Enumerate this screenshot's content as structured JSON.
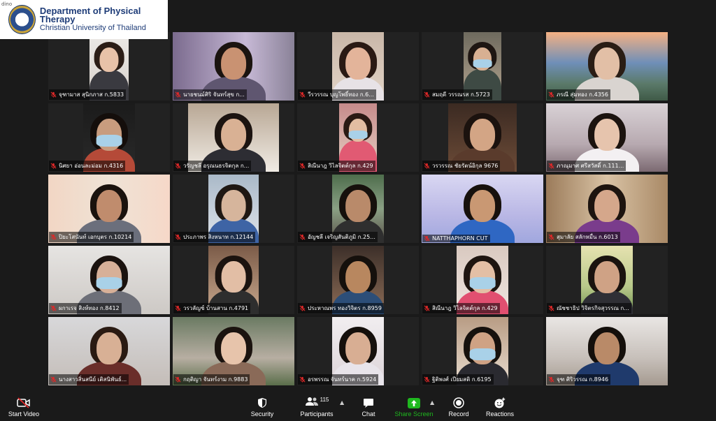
{
  "watermark": "dino",
  "logo": {
    "line1": "Department of Physical Therapy",
    "line2": "Christian University of Thailand"
  },
  "participants": [
    {
      "name": "จุฑามาส สุนิกภาส ก.5833"
    },
    {
      "name": "นายชนม์ศิริ จันทร์สุข ก..."
    },
    {
      "name": "วีรวรรณ บุญโพธิ์ทอง ก.6..."
    },
    {
      "name": "สมฤดี วรรณรส ก.5723"
    },
    {
      "name": "ภรณี สุ่มทอง ก.4356"
    },
    {
      "name": "นิศยา อ่อนละม่อม ก.4316"
    },
    {
      "name": "วรัญชลี อรุณนธรจิตกุล ก..."
    },
    {
      "name": "สิณีนาฎ วิไลจิตต์กุล ก.429"
    },
    {
      "name": "วรวรรณ ชัยรัตน์อิกุล 9676"
    },
    {
      "name": "ภาณุมาศ ศรีสวัสดิ์ ก.111..."
    },
    {
      "name": "ปิยะโสนันท์ เอกบุตร ก.10214"
    },
    {
      "name": "ประภาพร สิงหนาท ก.12144"
    },
    {
      "name": "อัญชลี เจริญสันติภูมิ ก.25..."
    },
    {
      "name": "NATTHAPHORN CUT"
    },
    {
      "name": "สุมาลัย สลักหมื่น ก.6013"
    },
    {
      "name": "ผกาเรจ สิงห์ทอง ก.8412"
    },
    {
      "name": "วรวลัญช์ บ้านสาน ก.4791"
    },
    {
      "name": "ประหาณพร ทองวิจิตร ก.8959"
    },
    {
      "name": "สิณีนาฎ วิไลจิตต์กุล ก.429"
    },
    {
      "name": "ณัชชาธิป วิจิตรกิจสุวรรณ ก..."
    },
    {
      "name": "นางสาวสิ่นสนีย์ เติสนิพันธ์..."
    },
    {
      "name": "กฤติญา จันทร์งาม ก.9883"
    },
    {
      "name": "อรพรรณ จันทร์นาค ก.5924"
    },
    {
      "name": "ฐิติพงศ์ เปียมสติ ก.6195"
    },
    {
      "name": "จุฑ ศิริวรรณ ก.8946"
    }
  ],
  "toolbar": {
    "start_video": "Start Video",
    "security": "Security",
    "participants": "Participants",
    "participants_count": "115",
    "chat": "Chat",
    "share_screen": "Share Screen",
    "record": "Record",
    "reactions": "Reactions"
  },
  "colors": {
    "share_screen": "#1fb81f",
    "muted_mic": "#e02828",
    "background": "#1a1a1a"
  },
  "icons": {
    "start_video": "video-off-icon",
    "security": "shield-icon",
    "participants": "people-icon",
    "chat": "chat-bubble-icon",
    "share_screen": "share-up-arrow-icon",
    "record": "record-icon",
    "reactions": "emoji-plus-icon"
  }
}
